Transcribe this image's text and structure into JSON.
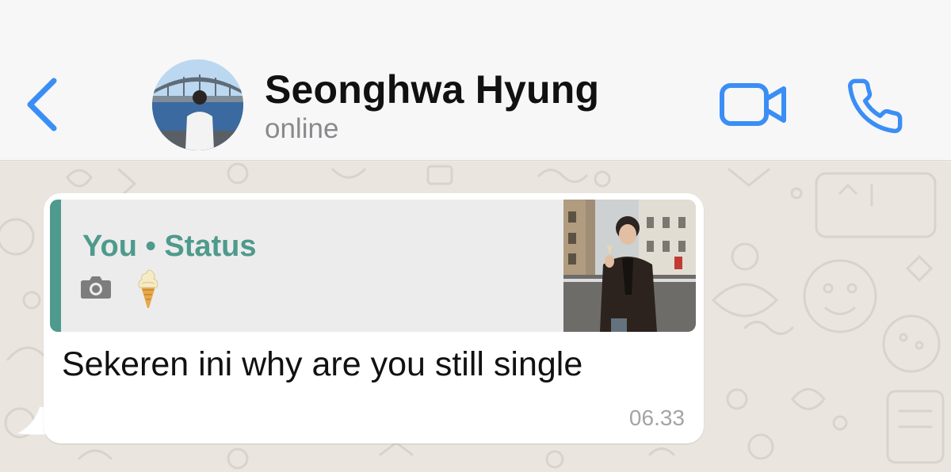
{
  "header": {
    "contact_name": "Seonghwa Hyung",
    "contact_status": "online",
    "icons": {
      "back": "chevron-left-icon",
      "video": "video-camera-icon",
      "call": "phone-icon"
    },
    "accent_color": "#3a8ef6"
  },
  "message": {
    "quote": {
      "title": "You • Status",
      "media_icon": "camera-icon",
      "emoji": "soft-ice-cream-icon",
      "accent_color": "#4e9a8c"
    },
    "text": "Sekeren ini why are you still single",
    "time": "06.33"
  }
}
